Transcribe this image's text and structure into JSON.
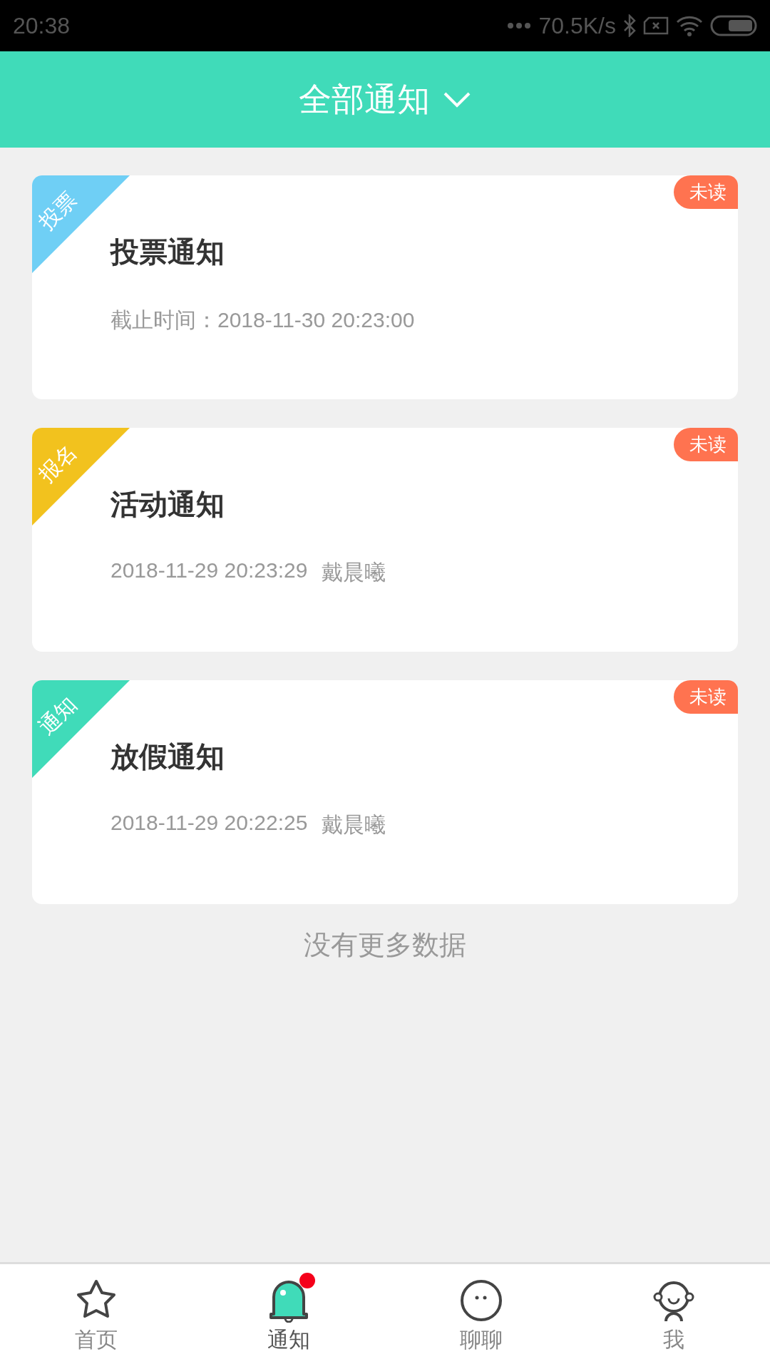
{
  "status_bar": {
    "time": "20:38",
    "speed": "70.5K/s"
  },
  "header": {
    "title": "全部通知"
  },
  "notifications": [
    {
      "tag": "投票",
      "color": "#6fcff5",
      "title": "投票通知",
      "time": "截止时间：2018-11-30 20:23:00",
      "unread": true,
      "status": "未读"
    },
    {
      "tag": "报名",
      "color": "#f2c21e",
      "title": "活动通知",
      "time": "2018-11-29 20:23:29",
      "author": "戴晨曦",
      "unread": true,
      "status": "未读"
    },
    {
      "tag": "通知",
      "color": "#40dbb9",
      "title": "放假通知",
      "time": "2018-11-29 20:22:25",
      "author": "戴晨曦",
      "unread": true,
      "status": "未读"
    }
  ],
  "footer": "没有更多数据",
  "tabs": [
    {
      "kind": "star",
      "label": "首页",
      "selected": false,
      "badge": false
    },
    {
      "kind": "bell",
      "label": "通知",
      "selected": true,
      "badge": true
    },
    {
      "kind": "chat",
      "label": "聊聊",
      "selected": false,
      "badge": false
    },
    {
      "kind": "person",
      "label": "我",
      "selected": false,
      "badge": false
    }
  ]
}
